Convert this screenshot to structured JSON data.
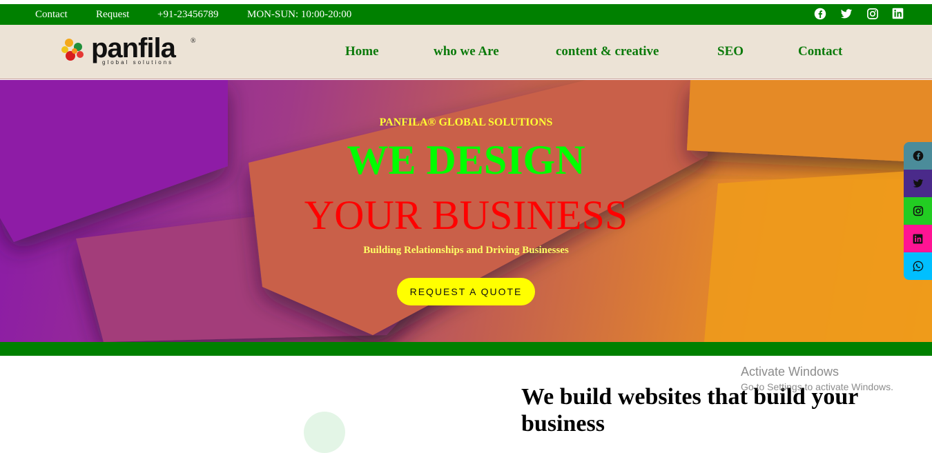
{
  "topbar": {
    "contact": "Contact",
    "request": "Request",
    "phone": "+91-23456789",
    "hours": "MON-SUN: 10:00-20:00",
    "social_icons": [
      "facebook-icon",
      "twitter-icon",
      "instagram-icon",
      "linkedin-icon"
    ]
  },
  "brand": {
    "name": "panfila",
    "tagline": "global solutions",
    "reg": "®"
  },
  "nav": {
    "items": [
      "Home",
      "who we Are",
      "content & creative",
      "SEO",
      "Contact"
    ]
  },
  "hero": {
    "kicker": "PANFILA® GLOBAL SOLUTIONS",
    "headline1": "WE DESIGN",
    "headline2": "YOUR BUSINESS",
    "tagline": "Building Relationships and Driving Businesses",
    "cta": "REQUEST A QUOTE"
  },
  "section": {
    "title_line1": "We build websites that build your",
    "title_line2": "business"
  },
  "floating_social": {
    "icons": [
      "facebook-icon",
      "twitter-icon",
      "instagram-icon",
      "linkedin-icon",
      "whatsapp-icon"
    ],
    "colors": [
      "#4b8c9a",
      "#4a2a8a",
      "#22cc22",
      "#ff1493",
      "#00bfff"
    ]
  },
  "watermark": {
    "line1": "Activate Windows",
    "line2": "Go to Settings to activate Windows."
  },
  "colors": {
    "topbar": "#008000",
    "header_bg": "#ece3d6",
    "nav_text": "#0b7a0b",
    "cta_bg": "#ffff00"
  }
}
